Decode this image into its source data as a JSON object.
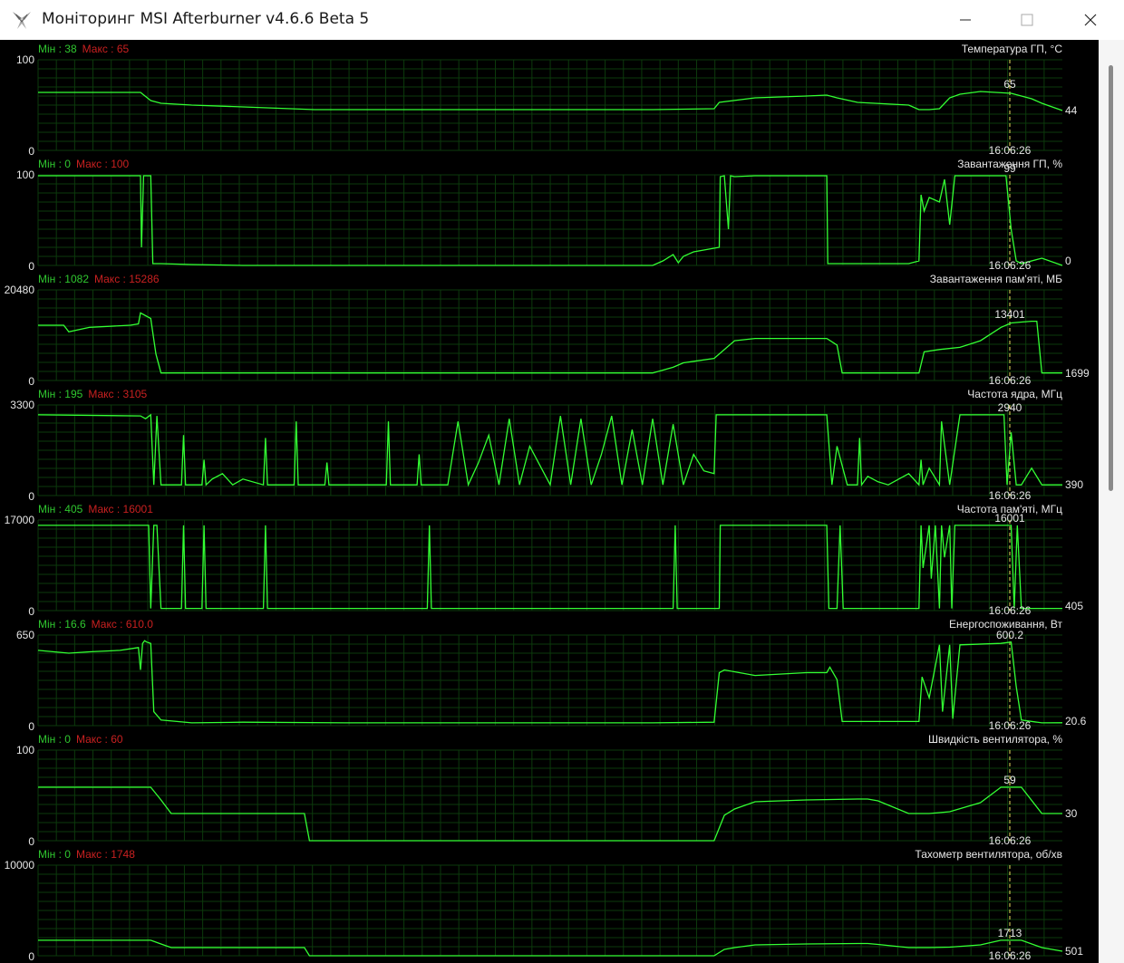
{
  "window": {
    "title": "Моніторинг MSI Afterburner v4.6.6 Beta 5"
  },
  "icons": {
    "app": "msi-afterburner-icon",
    "minimize": "minimize-icon",
    "maximize": "maximize-icon",
    "close": "close-icon"
  },
  "colors": {
    "line": "#33ff33",
    "grid": "#0c3a0c",
    "min_label": "#2fc72f",
    "max_label": "#c82020",
    "cursor": "#f0e060",
    "background": "#000000"
  },
  "labels": {
    "min_prefix": "Мін : ",
    "max_prefix": "Макс : "
  },
  "chart_data": [
    {
      "type": "line",
      "title": "Температура ГП, °С",
      "ylim": [
        0,
        100
      ],
      "min": "38",
      "max": "65",
      "current": "44",
      "peak": "65",
      "time": "16:06:26",
      "x": [
        0,
        5,
        10,
        11,
        12,
        15,
        20,
        27,
        30,
        40,
        50,
        60,
        66,
        66.5,
        70,
        75,
        77,
        78,
        80,
        85,
        86,
        87,
        88,
        89,
        90,
        92,
        95,
        97,
        98,
        100
      ],
      "y": [
        64,
        64,
        64,
        55,
        52,
        50,
        48,
        45,
        45,
        45,
        45,
        45,
        46,
        53,
        58,
        60,
        61,
        58,
        53,
        50,
        45,
        45,
        46,
        58,
        62,
        65,
        63,
        57,
        52,
        44
      ]
    },
    {
      "type": "line",
      "title": "Завантаження ГП, %",
      "ylim": [
        0,
        100
      ],
      "min": "0",
      "max": "100",
      "current": "0",
      "peak": "99",
      "time": "16:06:26",
      "x": [
        0,
        10,
        10.1,
        10.3,
        10.4,
        11,
        11.2,
        12,
        15,
        20,
        30,
        40,
        50,
        60,
        61,
        62,
        62.5,
        63,
        64,
        66.5,
        66.6,
        67,
        67.4,
        67.6,
        68,
        70,
        75,
        77,
        77.1,
        77.5,
        78,
        80,
        85,
        86,
        86.2,
        86.5,
        87,
        88,
        88.5,
        89,
        89.5,
        90,
        92,
        94,
        94.5,
        95,
        95.5,
        96,
        98,
        100
      ],
      "y": [
        99,
        99,
        20,
        99,
        99,
        99,
        2,
        2,
        1,
        0,
        0,
        0,
        0,
        0,
        5,
        12,
        3,
        10,
        15,
        20,
        98,
        99,
        40,
        99,
        98,
        99,
        99,
        99,
        2,
        2,
        2,
        2,
        2,
        5,
        78,
        60,
        75,
        70,
        95,
        45,
        99,
        99,
        99,
        99,
        99,
        40,
        5,
        2,
        8,
        0
      ]
    },
    {
      "type": "line",
      "title": "Завантаження пам'яті, МБ",
      "ylim": [
        0,
        20480
      ],
      "min": "1082",
      "max": "15286",
      "current": "1699",
      "peak": "13401",
      "time": "16:06:26",
      "x": [
        0,
        2.5,
        3,
        5,
        9,
        9.8,
        10,
        11,
        11.5,
        12,
        20,
        30,
        40,
        50,
        60,
        62,
        63,
        66,
        68,
        70,
        77,
        78,
        78.5,
        86,
        86.5,
        88,
        90,
        92,
        94,
        95,
        96,
        97,
        97.5,
        98,
        100
      ],
      "y": [
        12500,
        12500,
        11000,
        12000,
        12500,
        12800,
        15286,
        14000,
        6000,
        1699,
        1699,
        1699,
        1699,
        1699,
        1699,
        3000,
        4000,
        5000,
        9000,
        9500,
        9500,
        8000,
        1699,
        1699,
        6500,
        7000,
        7500,
        9000,
        12000,
        13000,
        13200,
        13401,
        13401,
        1699,
        1699
      ]
    },
    {
      "type": "line",
      "title": "Частота ядра, МГц",
      "ylim": [
        0,
        3300
      ],
      "min": "195",
      "max": "3105",
      "current": "390",
      "peak": "2940",
      "time": "16:06:26",
      "x": [
        0,
        10,
        10.5,
        11,
        11.3,
        11.6,
        12,
        14,
        14.2,
        14.4,
        16,
        16.2,
        16.4,
        17,
        18,
        19,
        20,
        22,
        22.2,
        22.4,
        25,
        25.2,
        25.4,
        28,
        28.2,
        28.4,
        34,
        34.2,
        34.4,
        37,
        37.2,
        37.4,
        40,
        41,
        42,
        43,
        44,
        45,
        46,
        47,
        48,
        50,
        51,
        52,
        53,
        54,
        55,
        56,
        57,
        58,
        59,
        60,
        61,
        62,
        63,
        64,
        65,
        66,
        66.2,
        67,
        70,
        75,
        77,
        77.5,
        78,
        79,
        80,
        80.2,
        80.4,
        81,
        82,
        83,
        85,
        86,
        86.2,
        86.4,
        87,
        88,
        88.2,
        89,
        90,
        92,
        94,
        94.3,
        94.6,
        95,
        95.5,
        96,
        97,
        98,
        100
      ],
      "y": [
        2940,
        2900,
        2800,
        2940,
        390,
        2900,
        390,
        390,
        2200,
        390,
        390,
        1300,
        390,
        600,
        800,
        390,
        600,
        390,
        2100,
        390,
        390,
        2700,
        390,
        390,
        1200,
        390,
        390,
        2700,
        390,
        390,
        1500,
        390,
        390,
        2700,
        390,
        1200,
        2200,
        390,
        2800,
        390,
        1800,
        390,
        2900,
        390,
        2800,
        390,
        1500,
        2900,
        390,
        2400,
        390,
        2800,
        390,
        2600,
        390,
        1500,
        900,
        800,
        2940,
        2940,
        2940,
        2940,
        2940,
        390,
        1800,
        390,
        390,
        2100,
        390,
        700,
        500,
        390,
        800,
        390,
        1300,
        390,
        1000,
        390,
        2700,
        390,
        2940,
        2940,
        2940,
        2940,
        390,
        2300,
        390,
        390,
        1000,
        390,
        390
      ]
    },
    {
      "type": "line",
      "title": "Частота пам'яті, МГц",
      "ylim": [
        0,
        17000
      ],
      "min": "405",
      "max": "16001",
      "current": "405",
      "peak": "16001",
      "time": "16:06:26",
      "x": [
        0,
        10.8,
        11,
        11.3,
        11.6,
        12,
        14,
        14.2,
        14.4,
        16,
        16.2,
        16.4,
        22,
        22.2,
        22.4,
        38,
        38.2,
        38.4,
        62,
        62.2,
        62.4,
        66.5,
        66.6,
        67,
        70,
        77,
        77.2,
        78,
        78.3,
        78.6,
        79,
        86,
        86.2,
        86.4,
        87,
        87.2,
        87.6,
        88,
        88.2,
        88.5,
        89,
        89.2,
        89.5,
        90,
        95,
        95.3,
        95.6,
        96,
        100
      ],
      "y": [
        16001,
        16001,
        405,
        16001,
        16001,
        405,
        405,
        16001,
        405,
        405,
        16001,
        405,
        405,
        16001,
        405,
        405,
        16001,
        405,
        405,
        16001,
        405,
        405,
        16001,
        16001,
        16001,
        16001,
        405,
        405,
        16001,
        405,
        405,
        405,
        16001,
        8000,
        16001,
        6000,
        16001,
        405,
        16001,
        10000,
        16001,
        405,
        16001,
        16001,
        16001,
        405,
        16001,
        405,
        405
      ]
    },
    {
      "type": "line",
      "title": "Енергоспоживання, Вт",
      "ylim": [
        0,
        650
      ],
      "min": "16.6",
      "max": "610.0",
      "current": "20.6",
      "peak": "600.2",
      "time": "16:06:26",
      "x": [
        0,
        3,
        5,
        8,
        9.8,
        10,
        10.2,
        10.4,
        10.6,
        11,
        11.3,
        12,
        15,
        20,
        30,
        40,
        50,
        60,
        66,
        66.5,
        67,
        70,
        75,
        77,
        77.3,
        78,
        78.5,
        86,
        86.3,
        87,
        88,
        88.3,
        89,
        89.3,
        90,
        94,
        95,
        95.5,
        96,
        98,
        100
      ],
      "y": [
        540,
        520,
        530,
        540,
        560,
        400,
        590,
        610,
        600,
        590,
        100,
        40,
        20,
        25,
        20,
        20,
        20,
        20,
        25,
        380,
        400,
        360,
        380,
        380,
        420,
        330,
        30,
        30,
        350,
        200,
        580,
        100,
        580,
        50,
        580,
        590,
        600.2,
        280,
        40,
        20,
        20.6
      ]
    },
    {
      "type": "line",
      "title": "Швидкість вентилятора, %",
      "ylim": [
        0,
        100
      ],
      "min": "0",
      "max": "60",
      "current": "30",
      "peak": "59",
      "time": "16:06:26",
      "x": [
        0,
        10,
        11,
        12,
        13,
        20,
        26,
        26.5,
        30,
        40,
        50,
        60,
        66,
        67,
        68,
        70,
        75,
        80,
        81,
        82,
        85,
        87,
        89,
        92,
        94,
        96,
        98,
        100
      ],
      "y": [
        59,
        59,
        59,
        45,
        30,
        30,
        30,
        0,
        0,
        0,
        0,
        0,
        0,
        28,
        35,
        43,
        45,
        46,
        46,
        44,
        30,
        30,
        32,
        42,
        59,
        59,
        30,
        30
      ]
    },
    {
      "type": "line",
      "title": "Тахометр вентилятора, об/хв",
      "ylim": [
        0,
        10000
      ],
      "min": "0",
      "max": "1748",
      "current": "501",
      "peak": "1713",
      "time": "16:06:26",
      "x": [
        0,
        10,
        11,
        12,
        13,
        20,
        26,
        26.5,
        30,
        40,
        50,
        60,
        66,
        67,
        68,
        70,
        75,
        80,
        81,
        82,
        85,
        87,
        89,
        92,
        94,
        96,
        98,
        100
      ],
      "y": [
        1713,
        1713,
        1713,
        1300,
        900,
        900,
        900,
        0,
        0,
        0,
        0,
        0,
        0,
        700,
        900,
        1200,
        1300,
        1350,
        1350,
        1250,
        900,
        900,
        950,
        1200,
        1713,
        1713,
        900,
        501
      ]
    }
  ]
}
